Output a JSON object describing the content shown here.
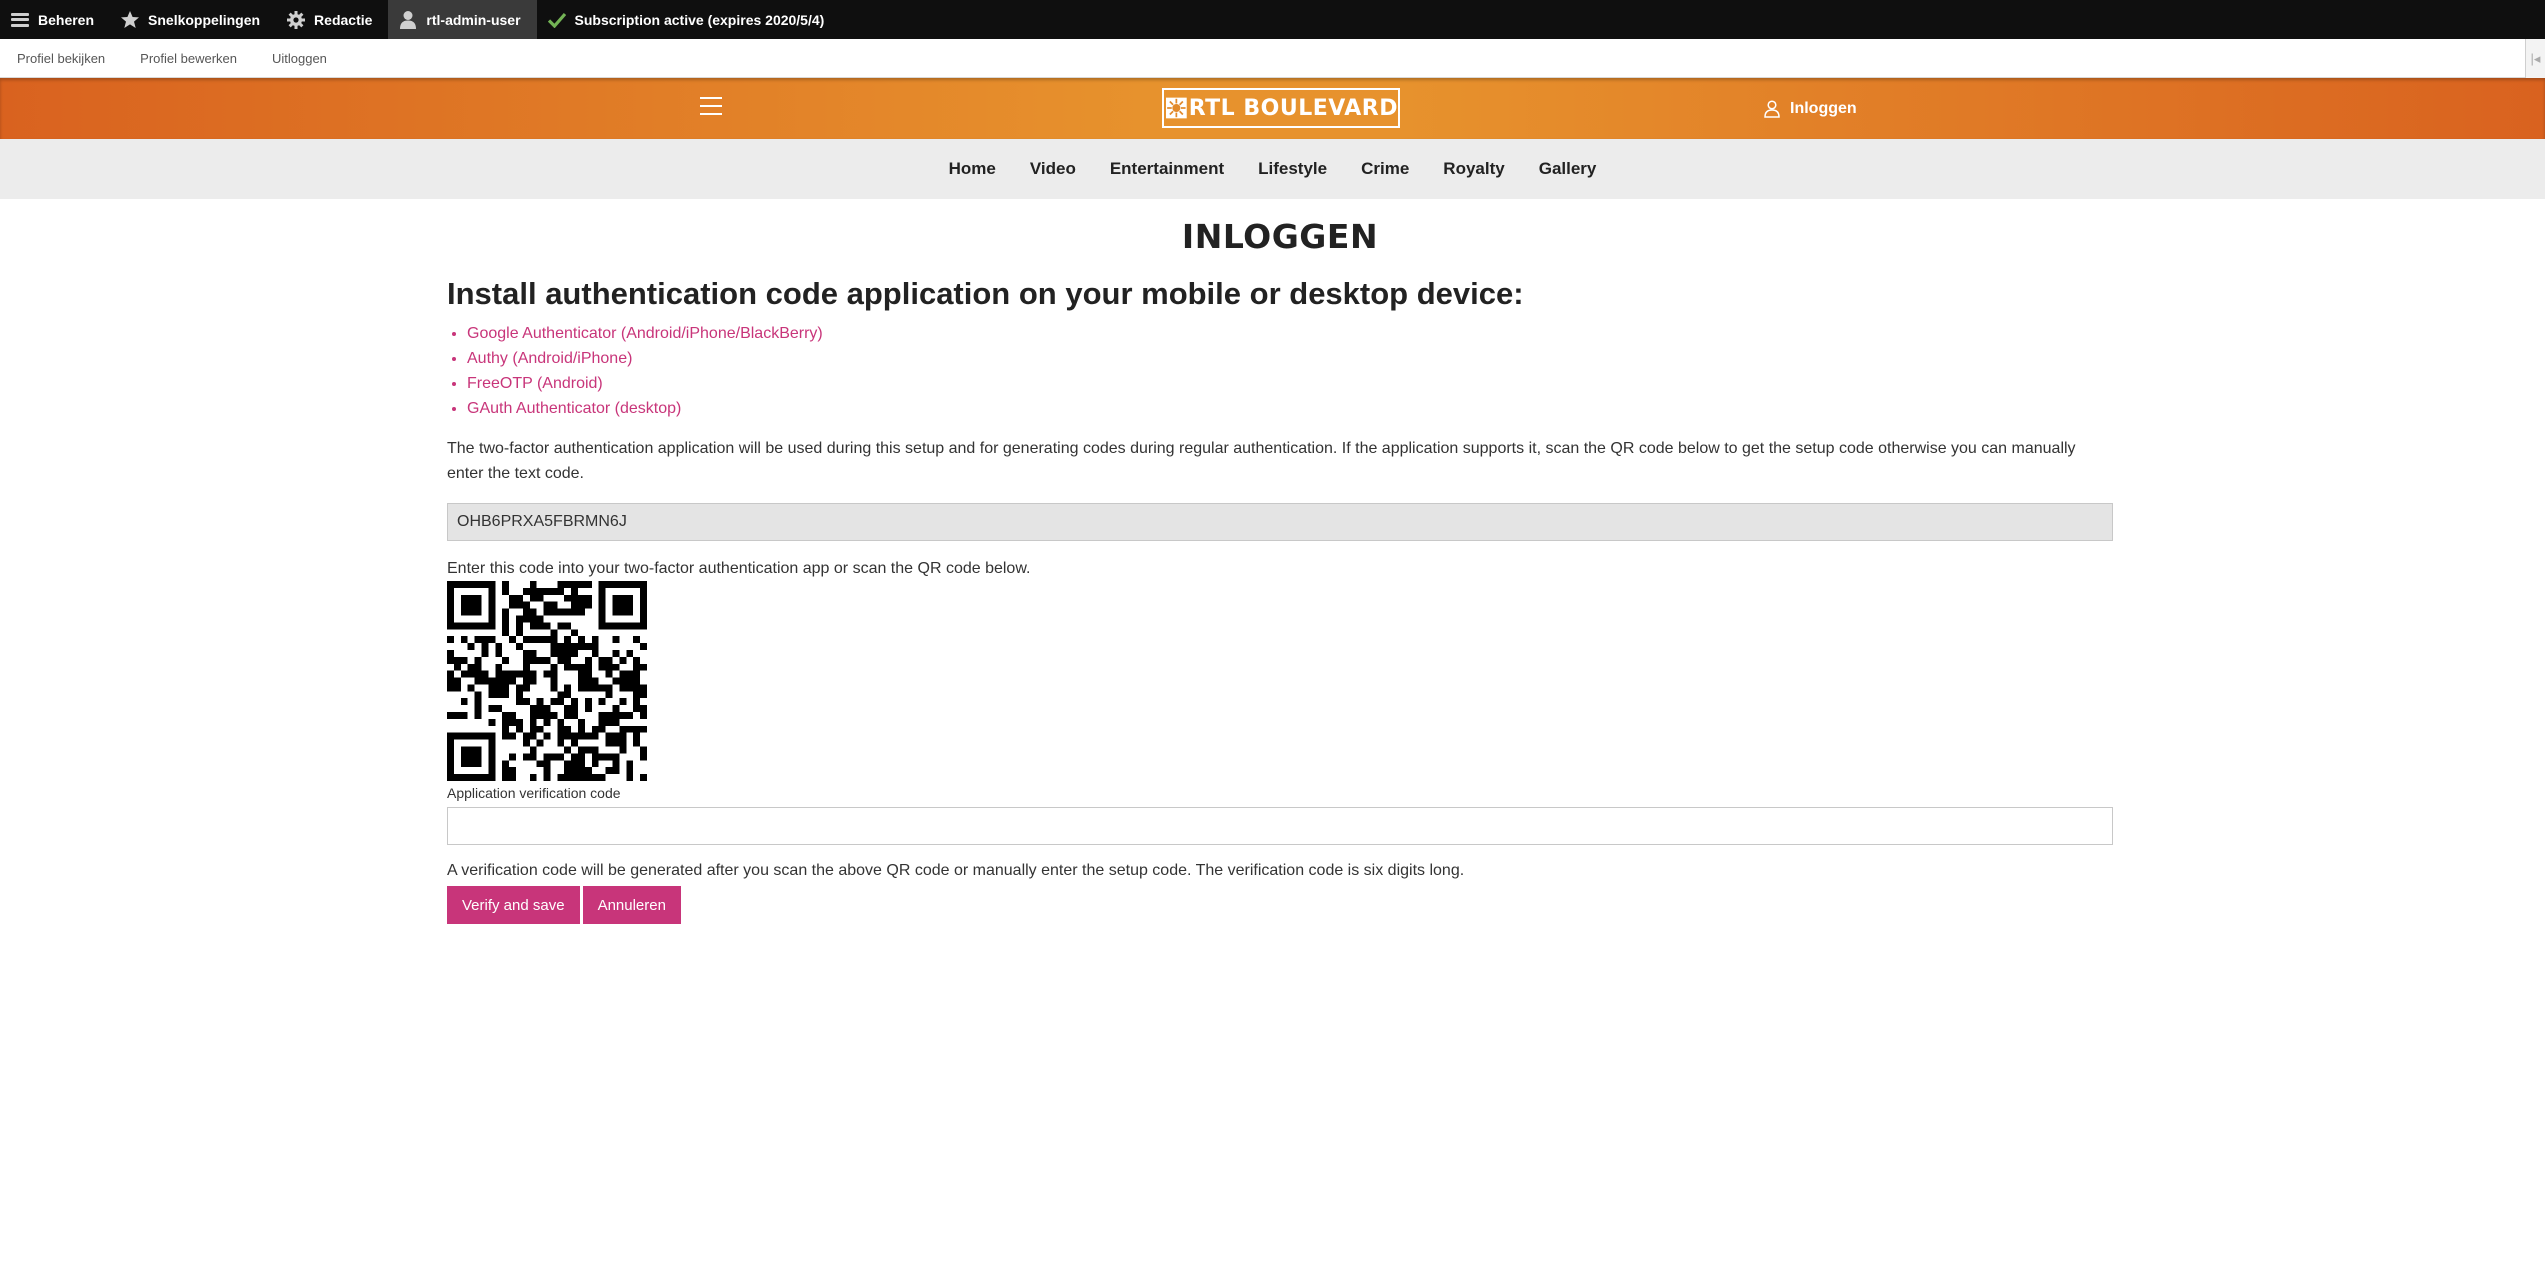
{
  "admin_toolbar": {
    "items": [
      {
        "label": "Beheren",
        "icon": "menu-icon"
      },
      {
        "label": "Snelkoppelingen",
        "icon": "star-icon"
      },
      {
        "label": "Redactie",
        "icon": "gear-icon"
      },
      {
        "label": "rtl-admin-user",
        "icon": "user-icon"
      },
      {
        "label": "Subscription active (expires 2020/5/4)",
        "icon": "checkmark-icon"
      }
    ],
    "sub_links": [
      "Profiel bekijken",
      "Profiel bewerken",
      "Uitloggen"
    ]
  },
  "header": {
    "logo_text": "RTL BOULEVARD",
    "login_label": "Inloggen",
    "brand_colors": {
      "orange_dark": "#d9621f",
      "orange_light": "#e7922d"
    }
  },
  "nav": {
    "items": [
      "Home",
      "Video",
      "Entertainment",
      "Lifestyle",
      "Crime",
      "Royalty",
      "Gallery"
    ]
  },
  "page": {
    "title": "INLOGGEN",
    "heading": "Install authentication code application on your mobile or desktop device:",
    "apps": [
      "Google Authenticator (Android/iPhone/BlackBerry)",
      "Authy (Android/iPhone)",
      "FreeOTP (Android)",
      "GAuth Authenticator (desktop)"
    ],
    "intro": "The two-factor authentication application will be used during this setup and for generating codes during regular authentication. If the application supports it, scan the QR code below to get the setup code otherwise you can manually enter the text code.",
    "secret_code": "OHB6PRXA5FBRMN6J",
    "scan_hint": "Enter this code into your two-factor authentication app or scan the QR code below.",
    "verification_label": "Application verification code",
    "verification_value": "",
    "verification_description": "A verification code will be generated after you scan the above QR code or manually enter the setup code. The verification code is six digits long.",
    "buttons": {
      "verify": "Verify and save",
      "cancel": "Annuleren"
    },
    "accent_color": "#c8357a"
  }
}
